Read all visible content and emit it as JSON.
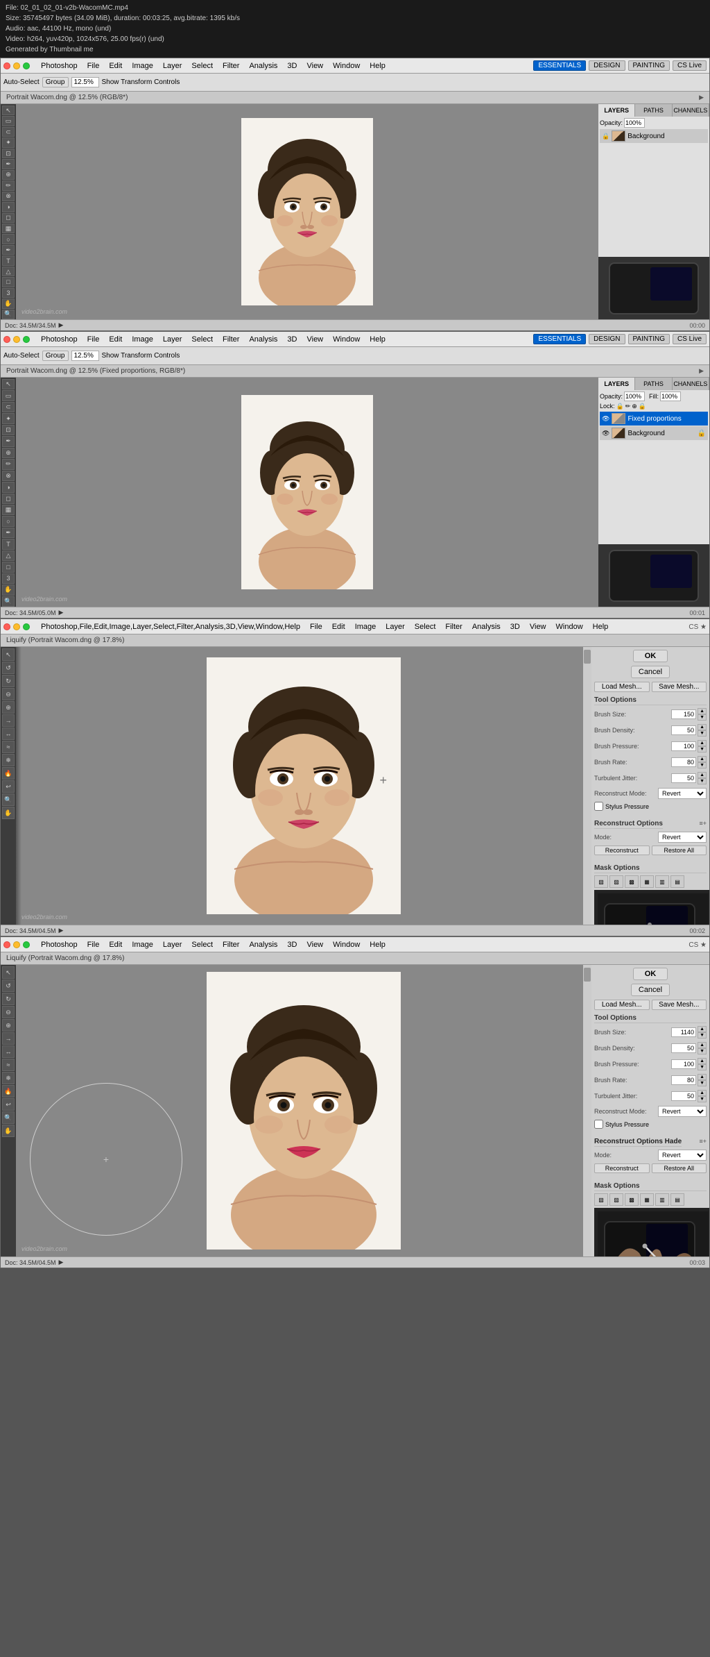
{
  "videoInfo": {
    "filename": "File: 02_01_02_01-v2b-WacomMC.mp4",
    "size": "Size: 35745497 bytes (34.09 MiB), duration: 00:03:25, avg.bitrate: 1395 kb/s",
    "audio": "Audio: aac, 44100 Hz, mono (und)",
    "video": "Video: h264, yuv420p, 1024x576, 25.00 fps(r) (und)",
    "generated": "Generated by Thumbnail me"
  },
  "window1": {
    "appName": "Photoshop",
    "menuItems": [
      "Photoshop",
      "File",
      "Edit",
      "Image",
      "Layer",
      "Select",
      "Filter",
      "Analysis",
      "3D",
      "View",
      "Window",
      "Help"
    ],
    "toolbar": {
      "autoSelect": "Auto-Select",
      "group": "Group",
      "showTransformControls": "Show Transform Controls",
      "zoomLevel": "12.5%"
    },
    "docTab": "Portrait Wacom.dng @ 12.5% (RGB/8*)",
    "statusBar": "Doc: 34.5M/34.5M",
    "workspaceButtons": [
      "ESSENTIALS",
      "DESIGN",
      "PAINTING",
      "CS Live"
    ],
    "layers": {
      "tabs": [
        "LAYERS",
        "PATHS",
        "CHANNELS"
      ],
      "opacity": "100%",
      "items": [
        {
          "name": "Background",
          "active": false
        }
      ]
    }
  },
  "window2": {
    "appName": "Photoshop",
    "menuItems": [
      "Photoshop",
      "File",
      "Edit",
      "Image",
      "Layer",
      "Select",
      "Filter",
      "Analysis",
      "3D",
      "View",
      "Window",
      "Help"
    ],
    "toolbar": {
      "autoSelect": "Auto-Select",
      "group": "Group",
      "showTransformControls": "Show Transform Controls",
      "zoomLevel": "12.5%"
    },
    "docTab": "Portrait Wacom.dng @ 12.5% (Fixed proportions, RGB/8*)",
    "statusBar": "Doc: 34.5M/05.0M",
    "workspaceButtons": [
      "ESSENTIALS",
      "DESIGN",
      "PAINTING",
      "CS Live"
    ],
    "layers": {
      "tabs": [
        "LAYERS",
        "PATHS",
        "CHANNELS"
      ],
      "opacity": "100%",
      "fill": "100%",
      "items": [
        {
          "name": "Fixed proportions",
          "active": true
        },
        {
          "name": "Background",
          "active": false
        }
      ]
    }
  },
  "window3": {
    "appName": "Photoshop",
    "menuItems": [
      "Photoshop",
      "File",
      "Edit",
      "Image",
      "Layer",
      "Select",
      "Filter",
      "Analysis",
      "3D",
      "View",
      "Window",
      "Help"
    ],
    "docTab": "Liquify (Portrait Wacom.dng @ 17.8%)",
    "liquify": {
      "okBtn": "OK",
      "cancelBtn": "Cancel",
      "loadMesh": "Load Mesh...",
      "saveMesh": "Save Mesh...",
      "toolOptions": "Tool Options",
      "brushSize": "Brush Size:",
      "brushSizeVal": "150",
      "brushDensity": "Brush Density:",
      "brushDensityVal": "50",
      "brushPressure": "Brush Pressure:",
      "brushPressureVal": "100",
      "brushRate": "Brush Rate:",
      "brushRateVal": "80",
      "turbulentJitter": "Turbulent Jitter:",
      "turbulentJitterVal": "50",
      "reconstructMode": "Reconstruct Mode:",
      "reconstructModeVal": "Revert",
      "stylusPressure": "Stylus Pressure",
      "reconstructOptions": "Reconstruct Options",
      "modeLabel": "Mode:",
      "modeVal": "Revert",
      "reconstruct": "Reconstruct",
      "restoreAll": "Restore All",
      "maskOptions": "Mask Options"
    }
  },
  "window4": {
    "appName": "Photoshop",
    "menuItems": [
      "Photoshop",
      "File",
      "Edit",
      "Image",
      "Layer",
      "Select",
      "Filter",
      "Analysis",
      "3D",
      "View",
      "Window",
      "Help"
    ],
    "docTab": "Liquify (Portrait Wacom.dng @ 17.8%)",
    "liquify": {
      "okBtn": "OK",
      "cancelBtn": "Cancel",
      "loadMesh": "Load Mesh...",
      "saveMesh": "Save Mesh...",
      "toolOptions": "Tool Options",
      "brushSize": "Brush Size:",
      "brushSizeVal": "1140",
      "brushDensity": "Brush Density:",
      "brushDensityVal": "50",
      "brushPressure": "Brush Pressure:",
      "brushPressureVal": "100",
      "brushRate": "Brush Rate:",
      "brushRateVal": "80",
      "turbulentJitter": "Turbulent Jitter:",
      "turbulentJitterVal": "50",
      "reconstructMode": "Reconstruct Mode:",
      "reconstructModeVal": "Revert",
      "stylusPressure": "Stylus Pressure",
      "reconstructOptions": "Reconstruct Options",
      "reconstructOptionsHeader": "Reconstruct Options Hade",
      "modeLabel": "Mode:",
      "modeVal": "Revert",
      "reconstruct": "Reconstruct",
      "restoreAll": "Restore All",
      "maskOptions": "Mask Options"
    }
  },
  "watermark": "video2brain.com",
  "icons": {
    "close": "✕",
    "minimize": "−",
    "maximize": "□",
    "lock": "🔒",
    "eye": "👁",
    "up": "▲",
    "down": "▼"
  }
}
